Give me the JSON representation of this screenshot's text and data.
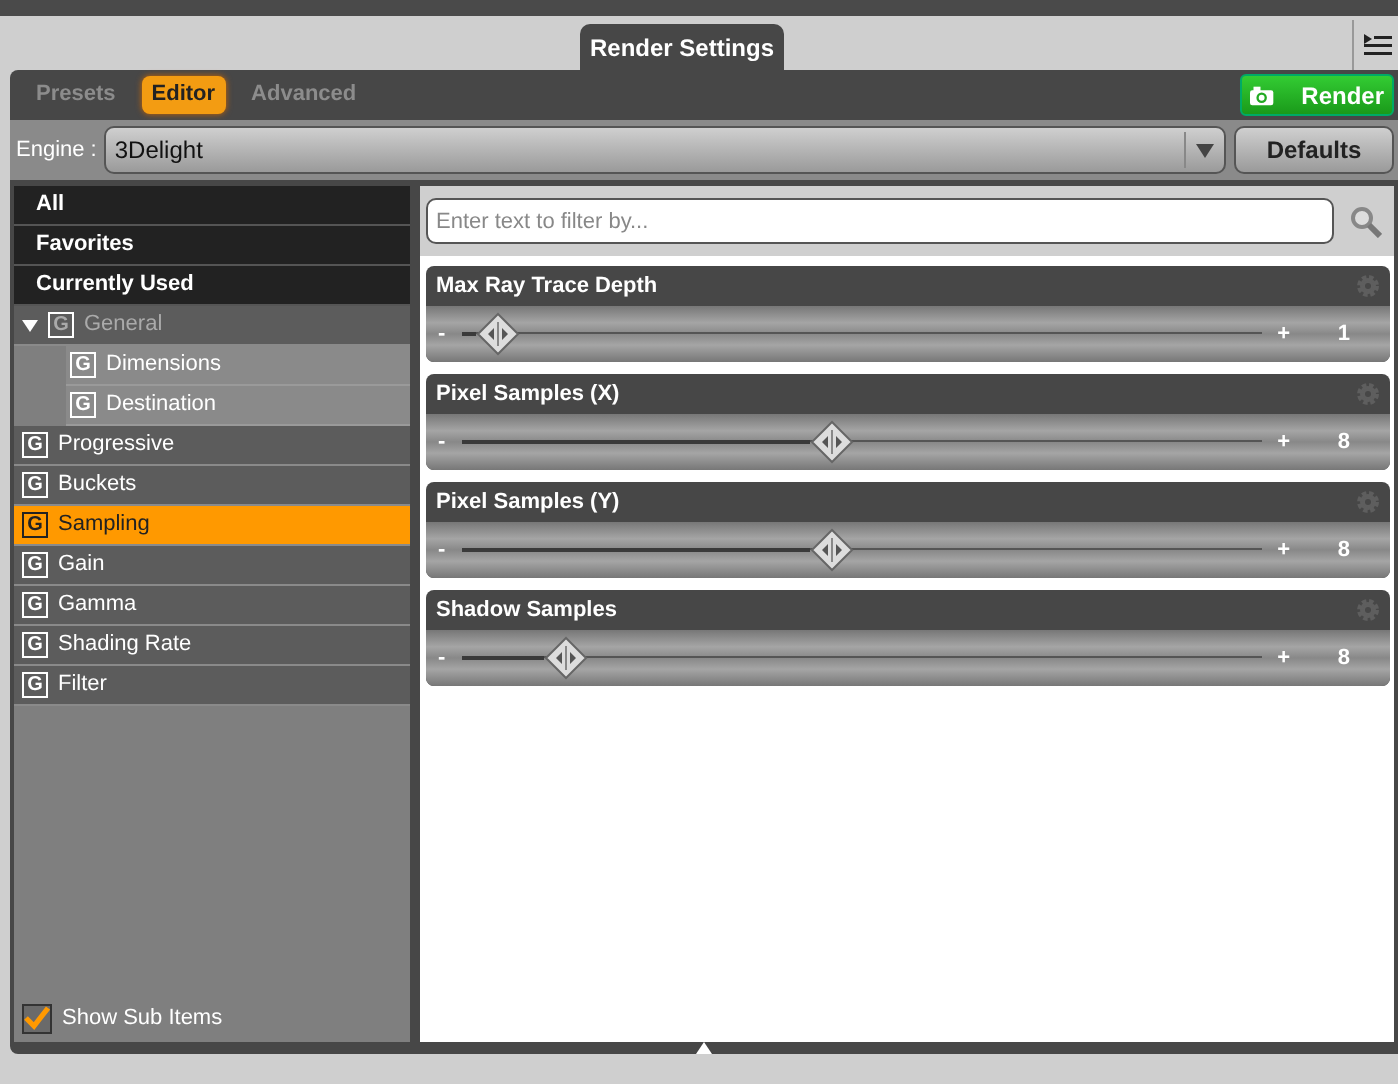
{
  "window": {
    "title": "Render Settings"
  },
  "tabs": [
    {
      "label": "Presets",
      "selected": false
    },
    {
      "label": "Editor",
      "selected": true
    },
    {
      "label": "Advanced",
      "selected": false
    }
  ],
  "render_button": {
    "label": "Render"
  },
  "engine": {
    "label": "Engine :",
    "value": "3Delight"
  },
  "defaults_button": {
    "label": "Defaults"
  },
  "categories": [
    {
      "label": "All"
    },
    {
      "label": "Favorites"
    },
    {
      "label": "Currently Used"
    }
  ],
  "groups": [
    {
      "icon": "G",
      "label": "General",
      "expanded": true,
      "selected": false,
      "disabled": true,
      "children": [
        {
          "icon": "G",
          "label": "Dimensions",
          "selected": false,
          "disabled": false
        },
        {
          "icon": "G",
          "label": "Destination",
          "selected": false,
          "disabled": false
        }
      ]
    },
    {
      "icon": "G",
      "label": "Progressive",
      "selected": false,
      "disabled": false
    },
    {
      "icon": "G",
      "label": "Buckets",
      "selected": false,
      "disabled": false
    },
    {
      "icon": "G",
      "label": "Sampling",
      "selected": true,
      "disabled": false
    },
    {
      "icon": "G",
      "label": "Gain",
      "selected": false,
      "disabled": false
    },
    {
      "icon": "G",
      "label": "Gamma",
      "selected": false,
      "disabled": false
    },
    {
      "icon": "G",
      "label": "Shading Rate",
      "selected": false,
      "disabled": false
    },
    {
      "icon": "G",
      "label": "Filter",
      "selected": false,
      "disabled": false
    }
  ],
  "show_sub_items": {
    "label": "Show Sub Items",
    "checked": true
  },
  "filter": {
    "placeholder": "Enter text to filter by..."
  },
  "properties": [
    {
      "name": "Max Ray Trace Depth",
      "minus": "-",
      "plus": "+",
      "level": 0.02,
      "reading": "1"
    },
    {
      "name": "Pixel Samples (X)",
      "minus": "-",
      "plus": "+",
      "level": 0.46,
      "reading": "8"
    },
    {
      "name": "Pixel Samples (Y)",
      "minus": "-",
      "plus": "+",
      "level": 0.46,
      "reading": "8"
    },
    {
      "name": "Shadow Samples",
      "minus": "-",
      "plus": "+",
      "level": 0.11,
      "reading": "8"
    }
  ]
}
